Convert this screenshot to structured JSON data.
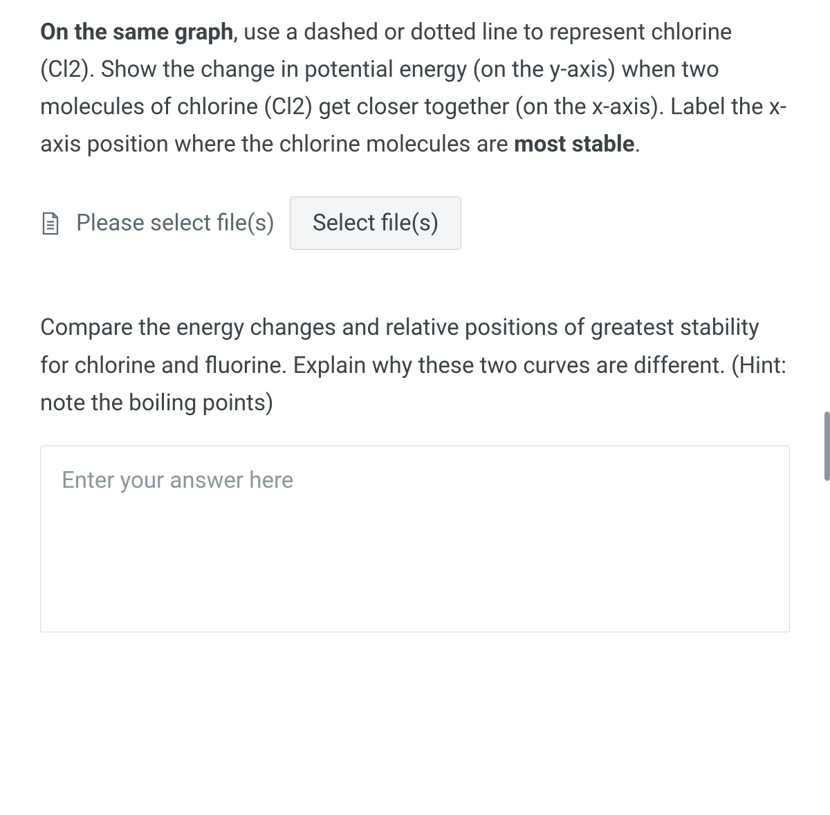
{
  "question1": {
    "parts": [
      {
        "text": "On the same graph",
        "bold": true
      },
      {
        "text": ", use a dashed or dotted line to represent chlorine (Cl2). Show the change in potential energy (on the y-axis) when two molecules of chlorine (Cl2) get closer together (on the x-axis). Label the x-axis position where the chlorine molecules are ",
        "bold": false
      },
      {
        "text": "most stable",
        "bold": true
      },
      {
        "text": ".",
        "bold": false
      }
    ]
  },
  "fileUpload": {
    "label": "Please select file(s)",
    "buttonLabel": "Select file(s)"
  },
  "question2": {
    "text": "Compare the energy changes and relative positions of greatest stability for chlorine and fluorine. Explain why these two curves are different. (Hint: note the boiling points)"
  },
  "answerInput": {
    "placeholder": "Enter your answer here",
    "value": ""
  }
}
